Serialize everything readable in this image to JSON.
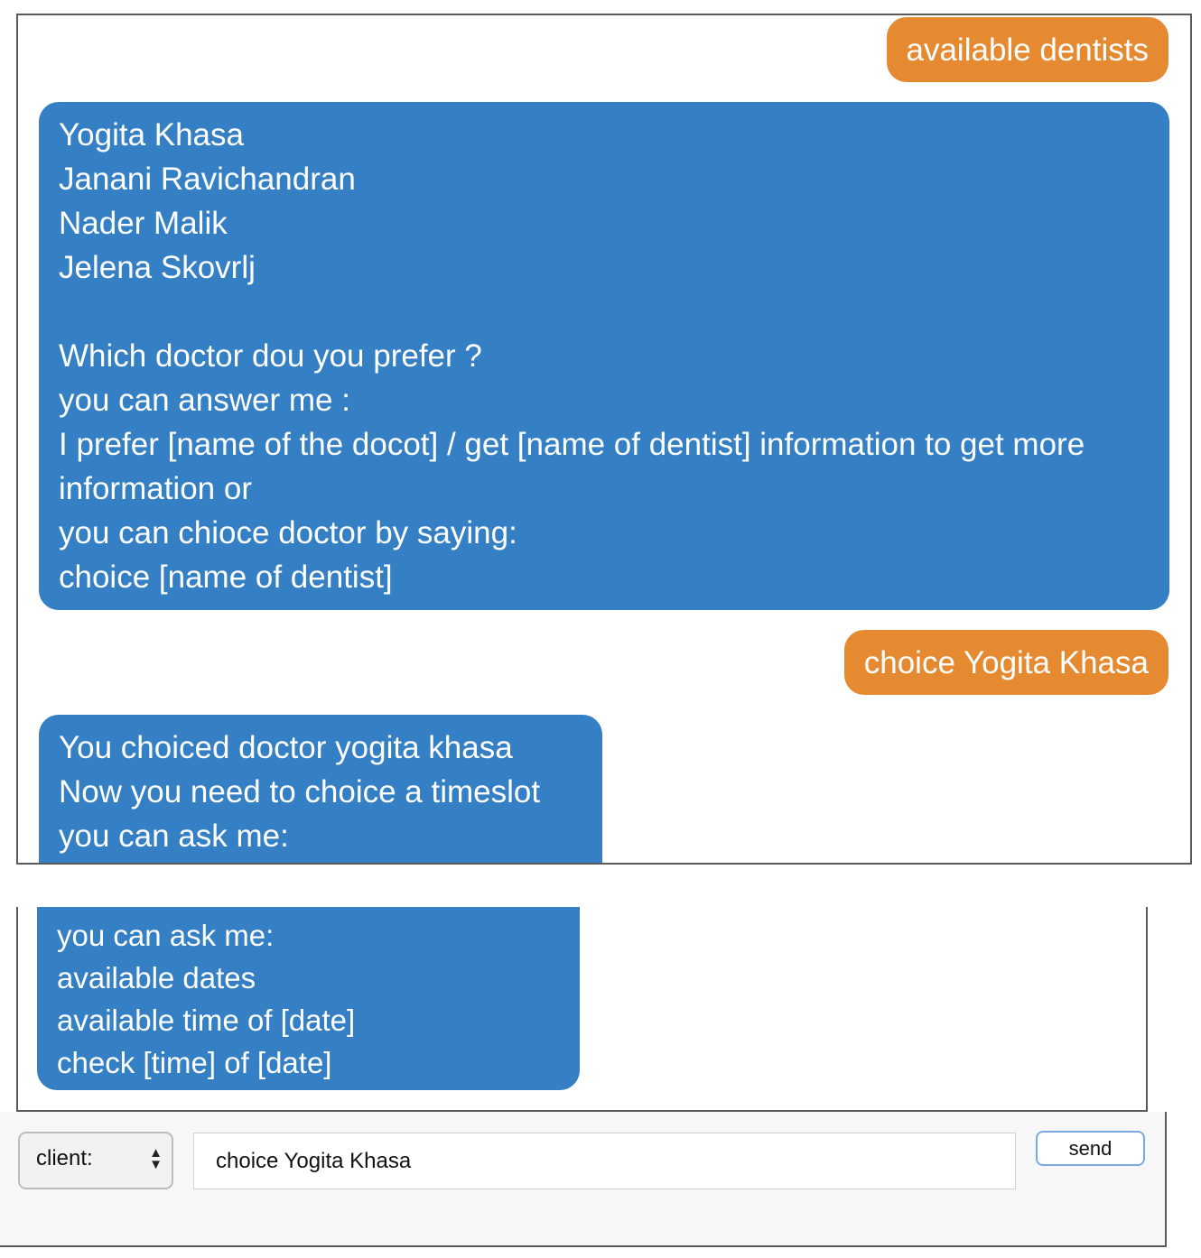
{
  "chat_top": {
    "messages": [
      {
        "sender": "client",
        "text": "available dentists"
      },
      {
        "sender": "bot",
        "text": "Yogita Khasa\nJanani Ravichandran\nNader Malik\nJelena Skovrlj\n\nWhich doctor dou you prefer ?\nyou can answer me :\nI prefer [name of the docot] / get [name of dentist] information to get more information or\nyou can chioce doctor by saying:\nchoice [name of dentist]"
      },
      {
        "sender": "client",
        "text": "choice Yogita Khasa"
      },
      {
        "sender": "bot",
        "text": "You choiced doctor yogita khasa\nNow you need to choice a timeslot\nyou can ask me:"
      }
    ]
  },
  "chat_bottom": {
    "messages": [
      {
        "sender": "bot",
        "text": "you can ask me:\navailable dates\navailable time of [date]\ncheck [time] of [date]"
      }
    ]
  },
  "form": {
    "role_select": {
      "selected": "client:"
    },
    "message_input": {
      "value": "choice Yogita Khasa"
    },
    "send_label": "send"
  },
  "colors": {
    "user_bubble": "#e58a30",
    "bot_bubble": "#3580c5",
    "send_border": "#7aa9e0"
  }
}
